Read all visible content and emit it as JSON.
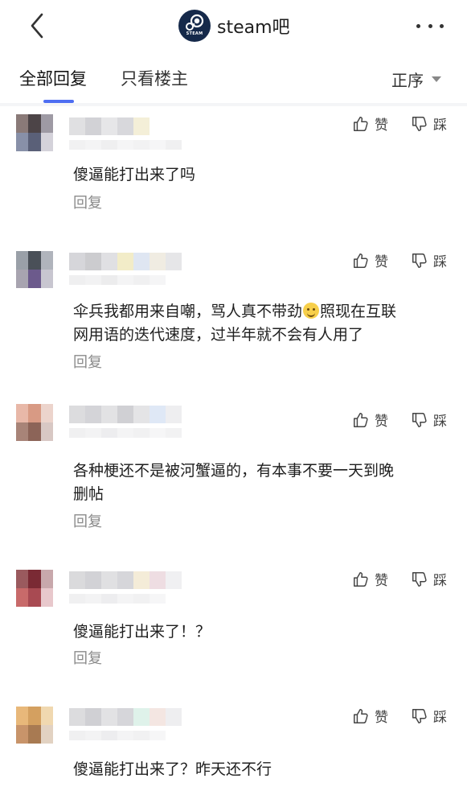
{
  "header": {
    "forum_title": "steam吧",
    "logo_word": "STEAM"
  },
  "tabs": {
    "all_replies": "全部回复",
    "op_only": "只看楼主",
    "sort": "正序"
  },
  "labels": {
    "like": "赞",
    "dislike": "踩",
    "reply": "回复"
  },
  "comments": [
    {
      "line1": "傻逼能打出来了吗",
      "line2": ""
    },
    {
      "line1": "伞兵我都用来自嘲，骂人真不带劲",
      "line1_after_emoji": "照现在互联",
      "line2": "网用语的迭代速度，过半年就不会有人用了"
    },
    {
      "line1": "各种梗还不是被河蟹逼的，有本事不要一天到晚",
      "line2": "删帖"
    },
    {
      "line1": "傻逼能打出来了！？",
      "line2": ""
    },
    {
      "line1": "傻逼能打出来了？昨天还不行",
      "line2": ""
    }
  ],
  "colors": {
    "accent": "#4e6ef2",
    "logo_bg": "#15294a"
  }
}
